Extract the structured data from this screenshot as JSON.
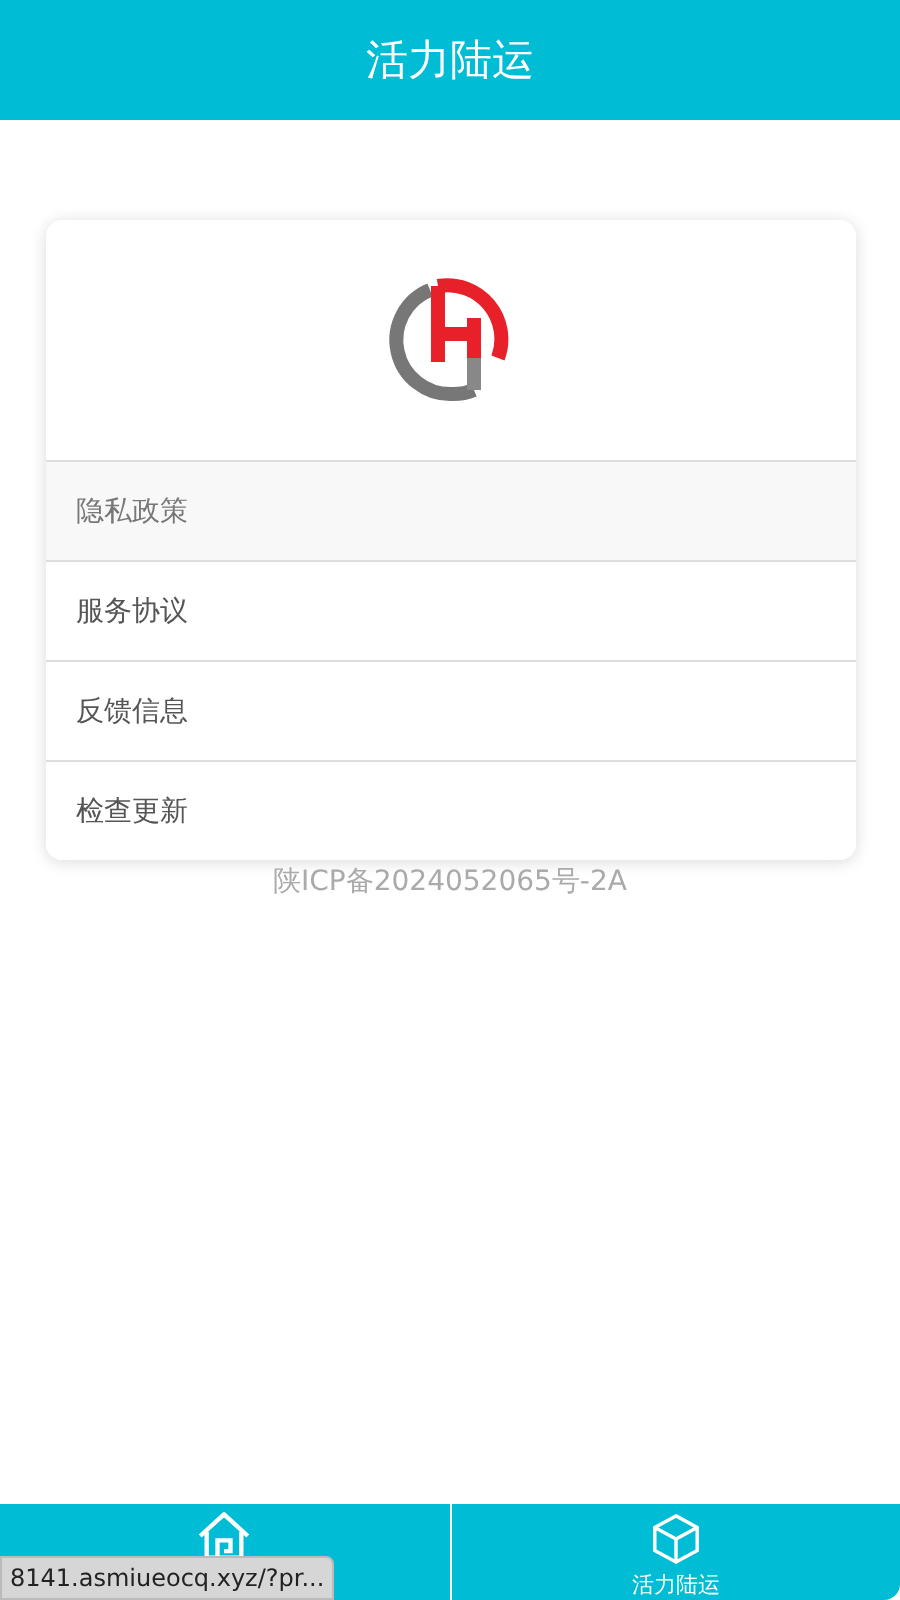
{
  "header": {
    "title": "活力陆运"
  },
  "menu": [
    {
      "label": "隐私政策",
      "selected": true
    },
    {
      "label": "服务协议",
      "selected": false
    },
    {
      "label": "反馈信息",
      "selected": false
    },
    {
      "label": "检查更新",
      "selected": false
    }
  ],
  "footer_note": "陕ICP备2024052065号-2A",
  "bottom_nav": [
    {
      "kind": "home"
    },
    {
      "kind": "box",
      "label": "活力陆运"
    }
  ],
  "status_url": "8141.asmiueocq.xyz/?pr..."
}
